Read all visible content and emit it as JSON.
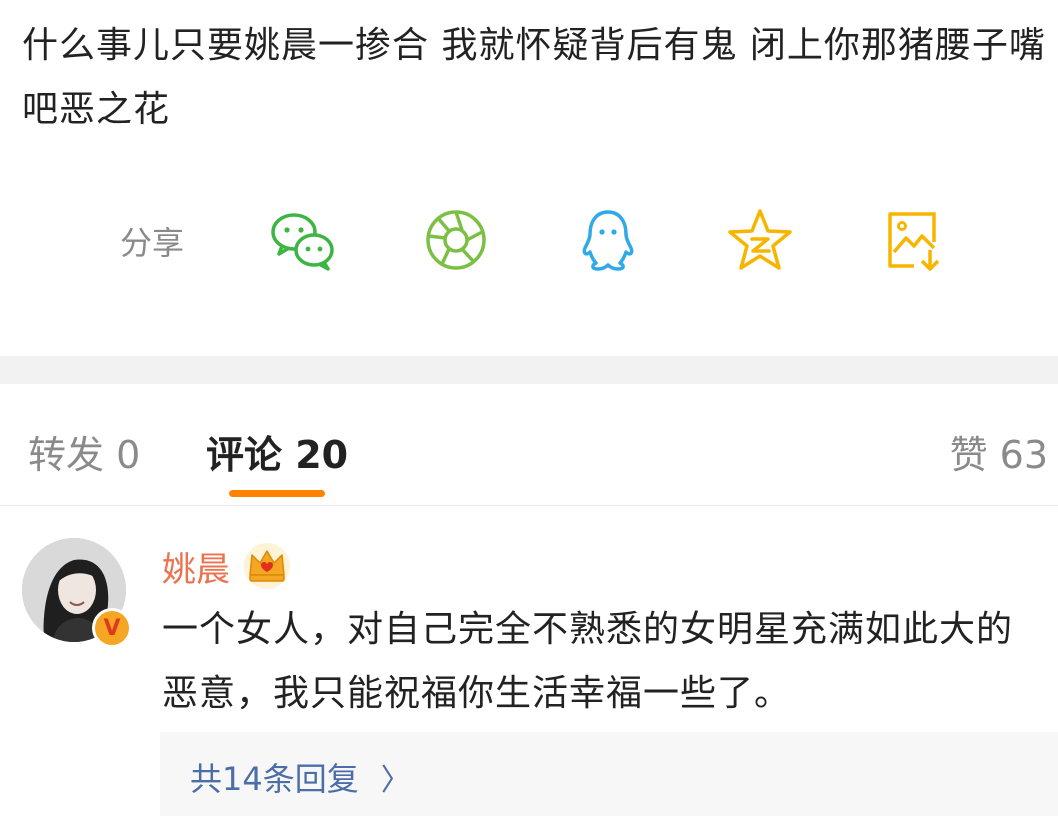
{
  "post": {
    "text": "什么事儿只要姚晨一掺合 我就怀疑背后有鬼 闭上你那猪腰子嘴吧恶之花"
  },
  "share": {
    "label": "分享",
    "buttons": [
      {
        "icon": "wechat-icon",
        "color": "#3db543"
      },
      {
        "icon": "moments-icon",
        "color": "#7bc043"
      },
      {
        "icon": "qq-icon",
        "color": "#2fa9e8"
      },
      {
        "icon": "qzone-star-icon",
        "color": "#f7b500"
      },
      {
        "icon": "save-image-icon",
        "color": "#f7b500"
      }
    ]
  },
  "tabs": {
    "repost": "转发 0",
    "comments": "评论 20",
    "likes": "赞 63",
    "active_color": "#ff8200"
  },
  "comment": {
    "author": "姚晨",
    "author_color": "#eb7350",
    "verified_badge": "V",
    "text": "一个女人，对自己完全不熟悉的女明星充满如此大的恶意，我只能祝福你生活幸福一些了。",
    "replies_label": "共14条回复",
    "replies_chevron": "〉"
  }
}
